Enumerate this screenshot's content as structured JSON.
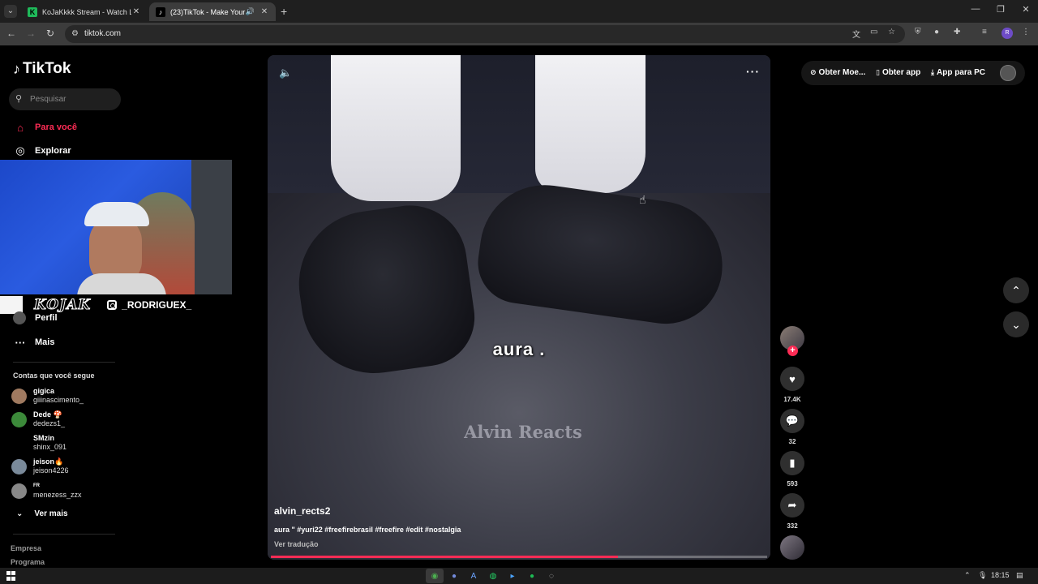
{
  "browser": {
    "tabs": [
      {
        "title": "KoJaKkkk Stream - Watch Live o",
        "favicon": "K",
        "active": false
      },
      {
        "title": "(23)TikTok - Make Your Day",
        "favicon": "♪",
        "active": true
      }
    ],
    "url": "tiktok.com",
    "new_tab_icon": "+",
    "profile_initial": "R"
  },
  "sidebar": {
    "logo": "TikTok",
    "search_placeholder": "Pesquisar",
    "nav": [
      {
        "label": "Para você",
        "icon": "home-icon",
        "active": true
      },
      {
        "label": "Explorar",
        "icon": "compass-icon",
        "active": false
      },
      {
        "label": "Perfil",
        "icon": "avatar",
        "active": false
      },
      {
        "label": "Mais",
        "icon": "more-icon",
        "active": false
      }
    ],
    "webcam_overlay": {
      "brand": "KOJAK",
      "instagram": "_RODRIGUEX_"
    },
    "following_title": "Contas que você segue",
    "following": [
      {
        "name": "gigica",
        "handle": "giiinascimento_",
        "color": "#a07a60"
      },
      {
        "name": "Dede 🍄",
        "handle": "dedezs1_",
        "color": "#3c8a3a"
      },
      {
        "name": "SMzin",
        "handle": "shinx_091",
        "color": "#000000"
      },
      {
        "name": "jeison🔥",
        "handle": "jeison4226",
        "color": "#7a8a9a"
      },
      {
        "name": "FR",
        "handle": "menezess_zzx",
        "color": "#888888"
      }
    ],
    "see_more": "Ver mais",
    "footer": [
      "Empresa",
      "Programa"
    ]
  },
  "video": {
    "caption": "aura .",
    "watermark": "Alvin Reacts",
    "author": "alvin_rects2",
    "description": "aura \" #yuri22 #freefirebrasil #freefire #edit #nostalgia",
    "translate": "Ver tradução",
    "progress_fraction": 0.7
  },
  "actions": {
    "likes": "17.4K",
    "comments": "32",
    "saves": "593",
    "shares": "332"
  },
  "top_right": {
    "coins": "Obter Moe...",
    "get_app": "Obter app",
    "pc_app": "App para PC"
  },
  "taskbar": {
    "time": "18:15"
  },
  "colors": {
    "accent": "#fe2c55",
    "background": "#000000"
  }
}
